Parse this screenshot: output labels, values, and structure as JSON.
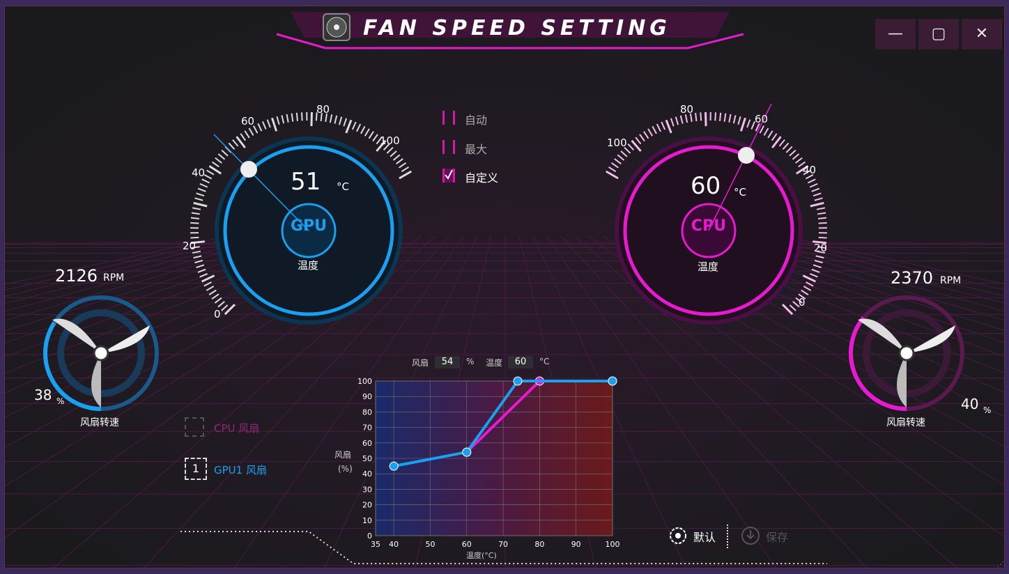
{
  "window": {
    "title": "FAN SPEED SETTING",
    "minimize": "—",
    "maximize": "▢",
    "close": "✕"
  },
  "gpu_gauge": {
    "ticks": [
      "0",
      "20",
      "40",
      "60",
      "80",
      "100"
    ],
    "temperature": "51",
    "unit": "°C",
    "center_label": "GPU",
    "sub_label": "温度",
    "accent": "#1aa0f0",
    "needle_value": 40
  },
  "cpu_gauge": {
    "ticks": [
      "0",
      "20",
      "40",
      "60",
      "80",
      "100"
    ],
    "temperature": "60",
    "unit": "°C",
    "center_label": "CPU",
    "sub_label": "温度",
    "accent": "#e81ad0",
    "needle_value": 60
  },
  "modes": [
    {
      "label": "自动",
      "checked": false
    },
    {
      "label": "最大",
      "checked": false
    },
    {
      "label": "自定义",
      "checked": true
    }
  ],
  "left_fan": {
    "rpm": "2126",
    "rpm_unit": "RPM",
    "percent": "38",
    "percent_unit": "%",
    "label": "风扇转速",
    "level": 0.38,
    "color": "#1aa0f0"
  },
  "right_fan": {
    "rpm": "2370",
    "rpm_unit": "RPM",
    "percent": "40",
    "percent_unit": "%",
    "label": "风扇转速",
    "level": 0.4,
    "color": "#e81ad0"
  },
  "fan_select": [
    {
      "label": "CPU 风扇",
      "active": false
    },
    {
      "label": "GPU1 风扇",
      "active": true
    }
  ],
  "readout": {
    "fan_label": "风扇",
    "fan_value": "54",
    "fan_unit": "%",
    "temp_label": "温度",
    "temp_value": "60",
    "temp_unit": "°C"
  },
  "chart_data": {
    "type": "line",
    "xlabel": "温度(°C)",
    "ylabel_top": "风扇",
    "ylabel_bottom": "(%)",
    "x_ticks": [
      "35",
      "40",
      "50",
      "60",
      "70",
      "80",
      "90",
      "100"
    ],
    "y_ticks": [
      "0",
      "10",
      "20",
      "30",
      "40",
      "50",
      "60",
      "70",
      "80",
      "90",
      "100"
    ],
    "xlim": [
      35,
      100
    ],
    "ylim": [
      0,
      100
    ],
    "series": [
      {
        "color": "#e81ad0",
        "points": [
          [
            60,
            54
          ],
          [
            80,
            100
          ],
          [
            100,
            100
          ]
        ]
      },
      {
        "color": "#1aa0f0",
        "points": [
          [
            40,
            45
          ],
          [
            60,
            54
          ],
          [
            74,
            100
          ],
          [
            100,
            100
          ]
        ]
      }
    ]
  },
  "actions": {
    "default_label": "默认",
    "save_label": "保存"
  }
}
